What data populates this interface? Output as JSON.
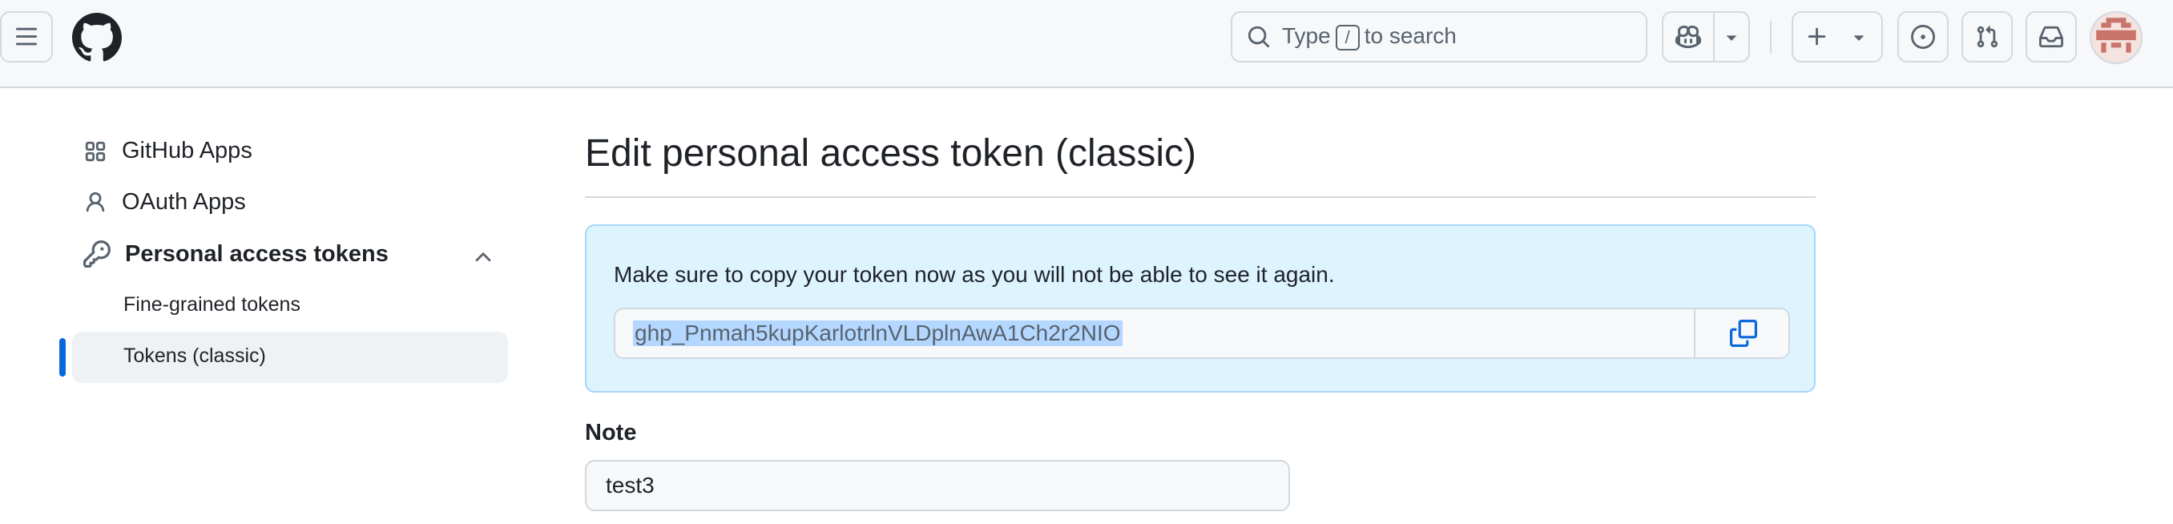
{
  "header": {
    "search_prefix": "Type",
    "search_key": "/",
    "search_suffix": "to search",
    "icons": [
      "hamburger-icon",
      "github-mark-icon",
      "search-icon",
      "copilot-icon",
      "triangle-down-icon",
      "plus-icon",
      "issue-opened-icon",
      "git-pull-request-icon",
      "inbox-icon"
    ]
  },
  "sidebar": {
    "items": [
      {
        "label": "GitHub Apps",
        "icon": "apps-icon"
      },
      {
        "label": "OAuth Apps",
        "icon": "person-icon"
      },
      {
        "label": "Personal access tokens",
        "icon": "key-icon",
        "expanded": true
      }
    ],
    "subitems": [
      {
        "label": "Fine-grained tokens",
        "active": false
      },
      {
        "label": "Tokens (classic)",
        "active": true
      }
    ]
  },
  "main": {
    "title": "Edit personal access token (classic)",
    "flash_message": "Make sure to copy your token now as you will not be able to see it again.",
    "token": "ghp_Pnmah5kupKarlotrlnVLDplnAwA1Ch2r2NIO",
    "note_label": "Note",
    "note_value": "test3"
  },
  "colors": {
    "accent": "#0969da",
    "flash_bg": "#ddf4ff",
    "flash_border": "#a6d5fa",
    "selection": "#b3d7ff"
  }
}
